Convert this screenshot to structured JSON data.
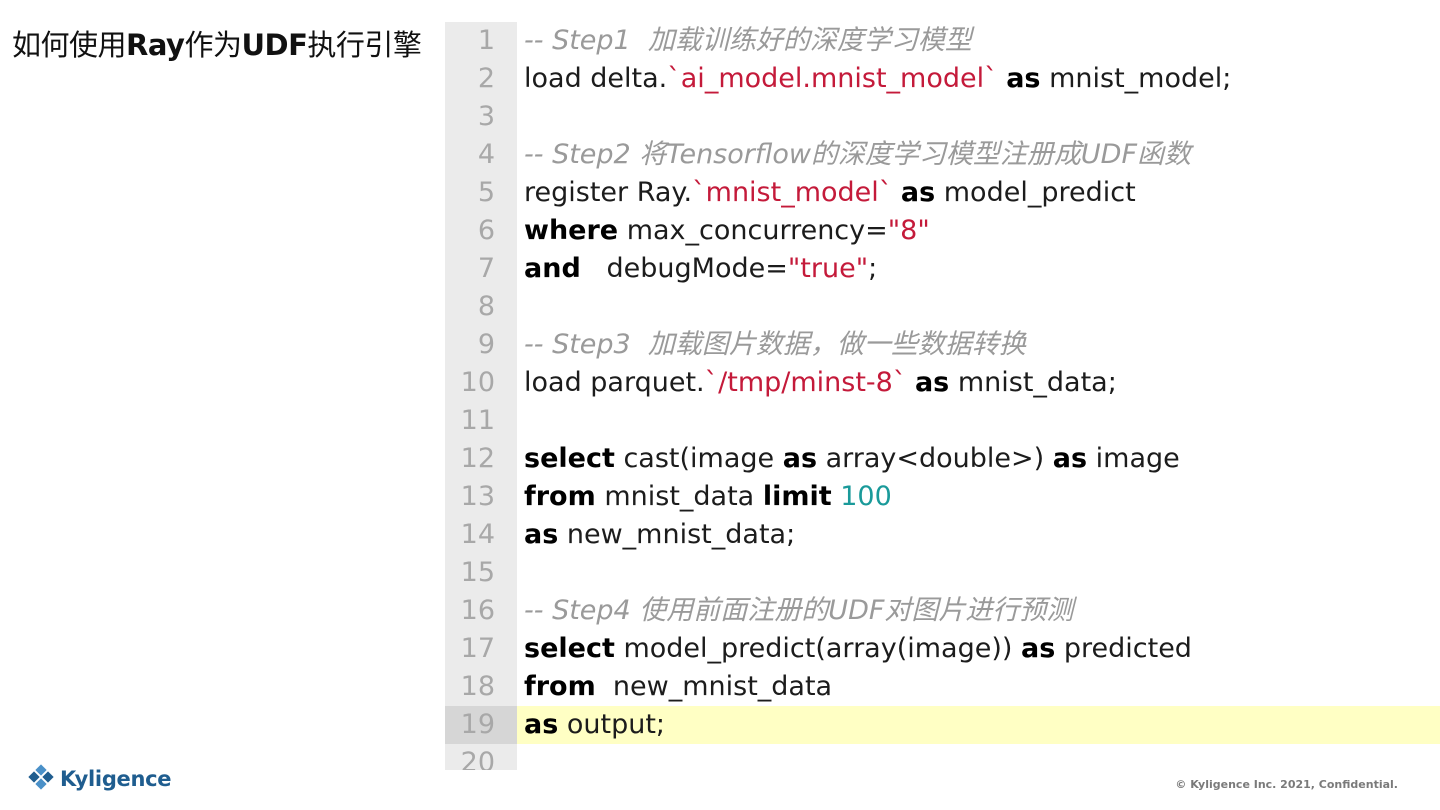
{
  "slide": {
    "title_parts": [
      "如何使用",
      "Ray",
      "作为",
      "UDF",
      "执行引擎"
    ]
  },
  "editor": {
    "lines": [
      {
        "no": "1",
        "tokens": [
          {
            "t": "-- Step1  加载训练好的深度学习模型",
            "k": "comment"
          }
        ]
      },
      {
        "no": "2",
        "tokens": [
          {
            "t": "load delta.",
            "k": "plain"
          },
          {
            "t": "`ai_model.mnist_model`",
            "k": "str"
          },
          {
            "t": " ",
            "k": "plain"
          },
          {
            "t": "as",
            "k": "kw"
          },
          {
            "t": " mnist_model;",
            "k": "plain"
          }
        ]
      },
      {
        "no": "3",
        "tokens": []
      },
      {
        "no": "4",
        "tokens": [
          {
            "t": "-- Step2 将Tensorflow的深度学习模型注册成UDF函数",
            "k": "comment"
          }
        ]
      },
      {
        "no": "5",
        "tokens": [
          {
            "t": "register Ray.",
            "k": "plain"
          },
          {
            "t": "`mnist_model`",
            "k": "str"
          },
          {
            "t": " ",
            "k": "plain"
          },
          {
            "t": "as",
            "k": "kw"
          },
          {
            "t": " model_predict",
            "k": "plain"
          }
        ]
      },
      {
        "no": "6",
        "tokens": [
          {
            "t": "where",
            "k": "kw"
          },
          {
            "t": " max_concurrency=",
            "k": "plain"
          },
          {
            "t": "\"8\"",
            "k": "str"
          }
        ]
      },
      {
        "no": "7",
        "tokens": [
          {
            "t": "and",
            "k": "kw"
          },
          {
            "t": "   debugMode=",
            "k": "plain"
          },
          {
            "t": "\"true\"",
            "k": "str"
          },
          {
            "t": ";",
            "k": "plain"
          }
        ]
      },
      {
        "no": "8",
        "tokens": []
      },
      {
        "no": "9",
        "tokens": [
          {
            "t": "-- Step3  加载图片数据，做一些数据转换",
            "k": "comment"
          }
        ]
      },
      {
        "no": "10",
        "tokens": [
          {
            "t": "load parquet.",
            "k": "plain"
          },
          {
            "t": "`/tmp/minst-8`",
            "k": "str"
          },
          {
            "t": " ",
            "k": "plain"
          },
          {
            "t": "as",
            "k": "kw"
          },
          {
            "t": " mnist_data;",
            "k": "plain"
          }
        ]
      },
      {
        "no": "11",
        "tokens": []
      },
      {
        "no": "12",
        "tokens": [
          {
            "t": "select",
            "k": "kw"
          },
          {
            "t": " cast(image ",
            "k": "plain"
          },
          {
            "t": "as",
            "k": "kw"
          },
          {
            "t": " array<double>) ",
            "k": "plain"
          },
          {
            "t": "as",
            "k": "kw"
          },
          {
            "t": " image",
            "k": "plain"
          }
        ]
      },
      {
        "no": "13",
        "tokens": [
          {
            "t": "from",
            "k": "kw"
          },
          {
            "t": " mnist_data ",
            "k": "plain"
          },
          {
            "t": "limit",
            "k": "kw"
          },
          {
            "t": " ",
            "k": "plain"
          },
          {
            "t": "100",
            "k": "num"
          }
        ]
      },
      {
        "no": "14",
        "tokens": [
          {
            "t": "as",
            "k": "kw"
          },
          {
            "t": " new_mnist_data;",
            "k": "plain"
          }
        ]
      },
      {
        "no": "15",
        "tokens": []
      },
      {
        "no": "16",
        "tokens": [
          {
            "t": "-- Step4 使用前面注册的UDF对图片进行预测",
            "k": "comment"
          }
        ]
      },
      {
        "no": "17",
        "tokens": [
          {
            "t": "select",
            "k": "kw"
          },
          {
            "t": " model_predict(array(image)) ",
            "k": "plain"
          },
          {
            "t": "as",
            "k": "kw"
          },
          {
            "t": " predicted",
            "k": "plain"
          }
        ]
      },
      {
        "no": "18",
        "tokens": [
          {
            "t": "from",
            "k": "kw"
          },
          {
            "t": "  new_mnist_data",
            "k": "plain"
          }
        ]
      },
      {
        "no": "19",
        "active": true,
        "tokens": [
          {
            "t": "as",
            "k": "kw"
          },
          {
            "t": " output;",
            "k": "plain"
          }
        ]
      },
      {
        "no": "20",
        "tokens": []
      }
    ]
  },
  "brand": {
    "logo_text": "Kyligence",
    "logo_mark": "kyligence-diamond-icon",
    "colors": {
      "primary": "#1f5d8f",
      "accent": "#4a90c8"
    },
    "footer": "© Kyligence Inc. 2021, Confidential."
  },
  "colors": {
    "keyword": "#000000",
    "string": "#c41a3a",
    "comment": "#9a9a9a",
    "number": "#1a9a9a",
    "gutter_bg": "#ebebeb",
    "active_line_bg": "#ffffc4"
  }
}
